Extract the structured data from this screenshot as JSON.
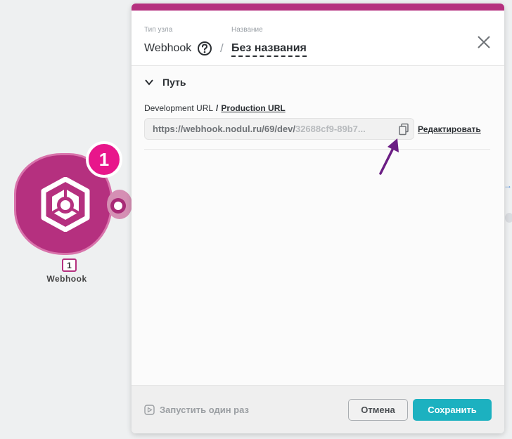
{
  "colors": {
    "accent": "#b5307f",
    "badge": "#e8168b",
    "primary_button": "#1cb1c0",
    "pointer_arrow": "#6b1e84"
  },
  "canvas": {
    "node": {
      "badge_number": "1",
      "index_label": "1",
      "name": "Webhook",
      "icon": "webhook-hexagon-icon"
    }
  },
  "panel": {
    "header": {
      "type_label": "Тип узла",
      "type_value": "Webhook",
      "name_label": "Название",
      "separator": "/",
      "name_value": "Без названия",
      "help_icon": "question-circle-icon",
      "close_icon": "close-icon"
    },
    "section": {
      "title": "Путь",
      "expanded": true,
      "url_tabs": {
        "dev": "Development URL",
        "separator": "/",
        "prod": "Production URL"
      },
      "url_main": "https://webhook.nodul.ru/69/dev/",
      "url_rest": "32688cf9-89b7...",
      "copy_icon": "copy-icon",
      "edit_label": "Редактировать"
    },
    "footer": {
      "run_once_label": "Запустить один раз",
      "cancel_label": "Отмена",
      "save_label": "Сохранить"
    }
  }
}
